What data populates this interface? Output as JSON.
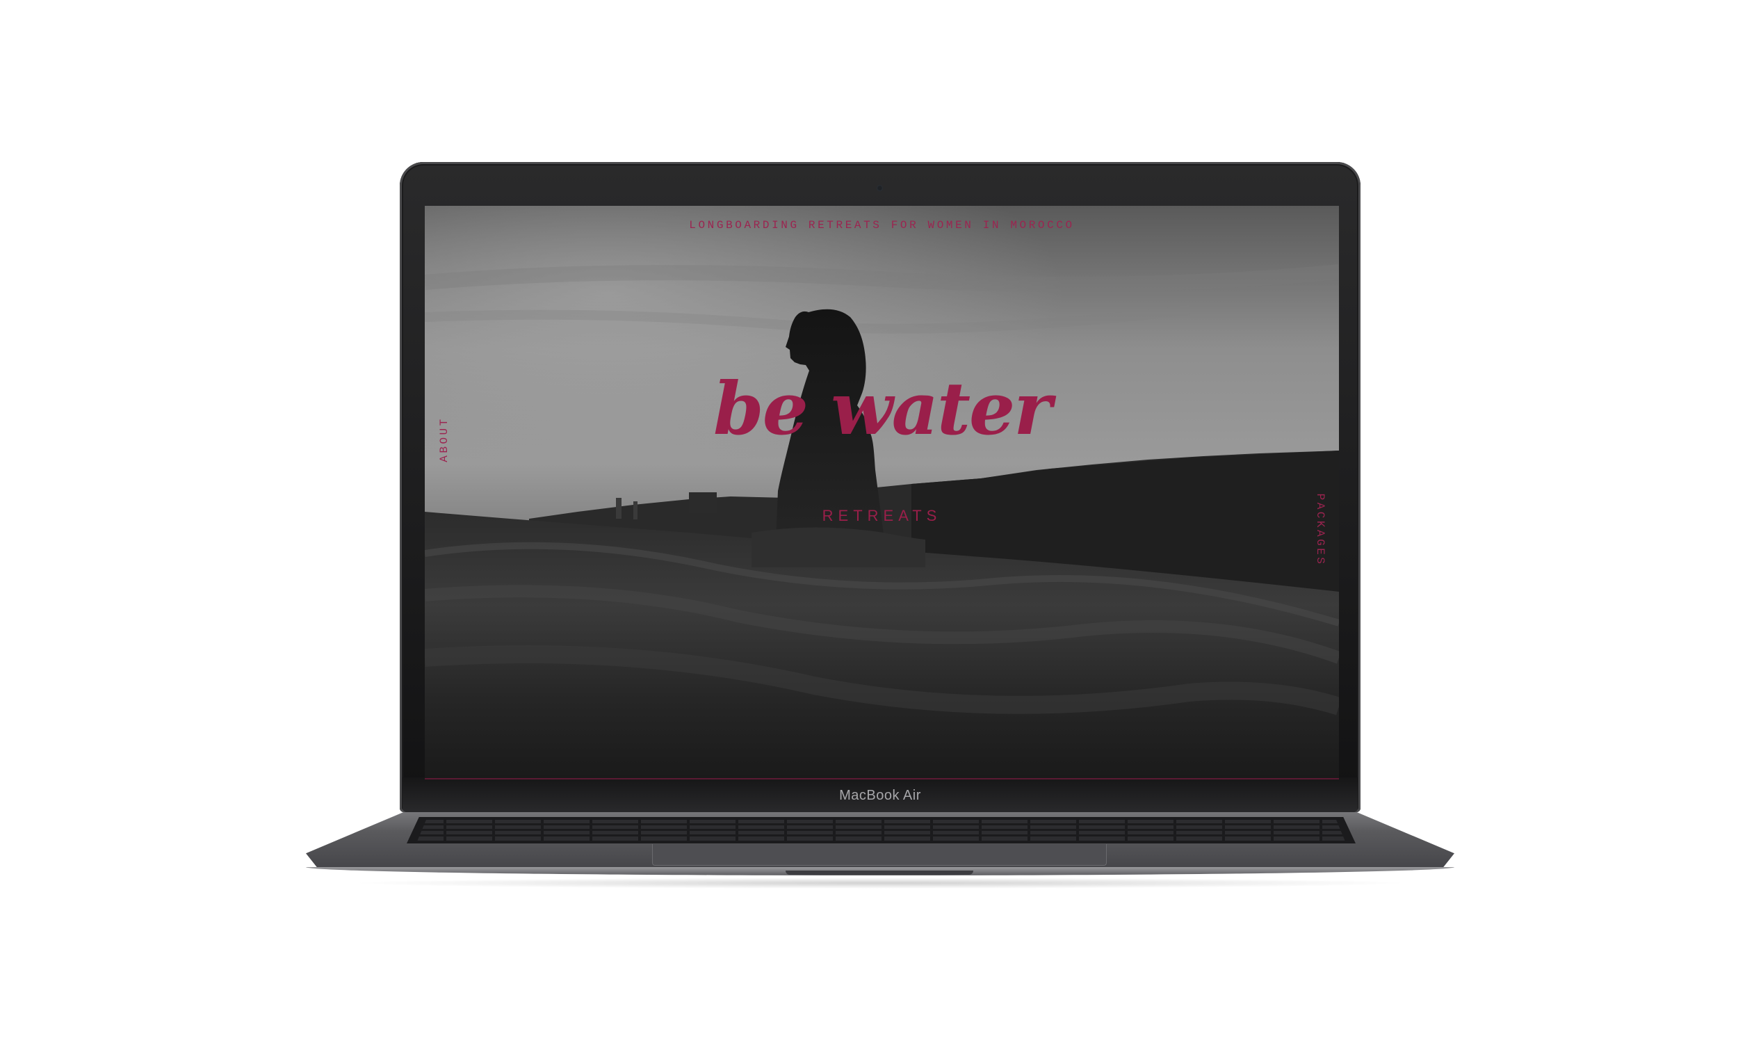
{
  "device": {
    "label": "MacBook Air"
  },
  "site": {
    "tagline": "LONGBOARDING RETREATS FOR WOMEN IN MOROCCO",
    "logo": {
      "title": "be water",
      "subtitle": "RETREATS"
    },
    "nav": {
      "left": "ABOUT",
      "right": "PACKAGES"
    },
    "hero_image": "surfer-silhouette-ocean-bw"
  },
  "colors": {
    "accent": "#9a1f4a",
    "laptop_body": "#5a5a5d",
    "screen_bezel": "#121213"
  }
}
